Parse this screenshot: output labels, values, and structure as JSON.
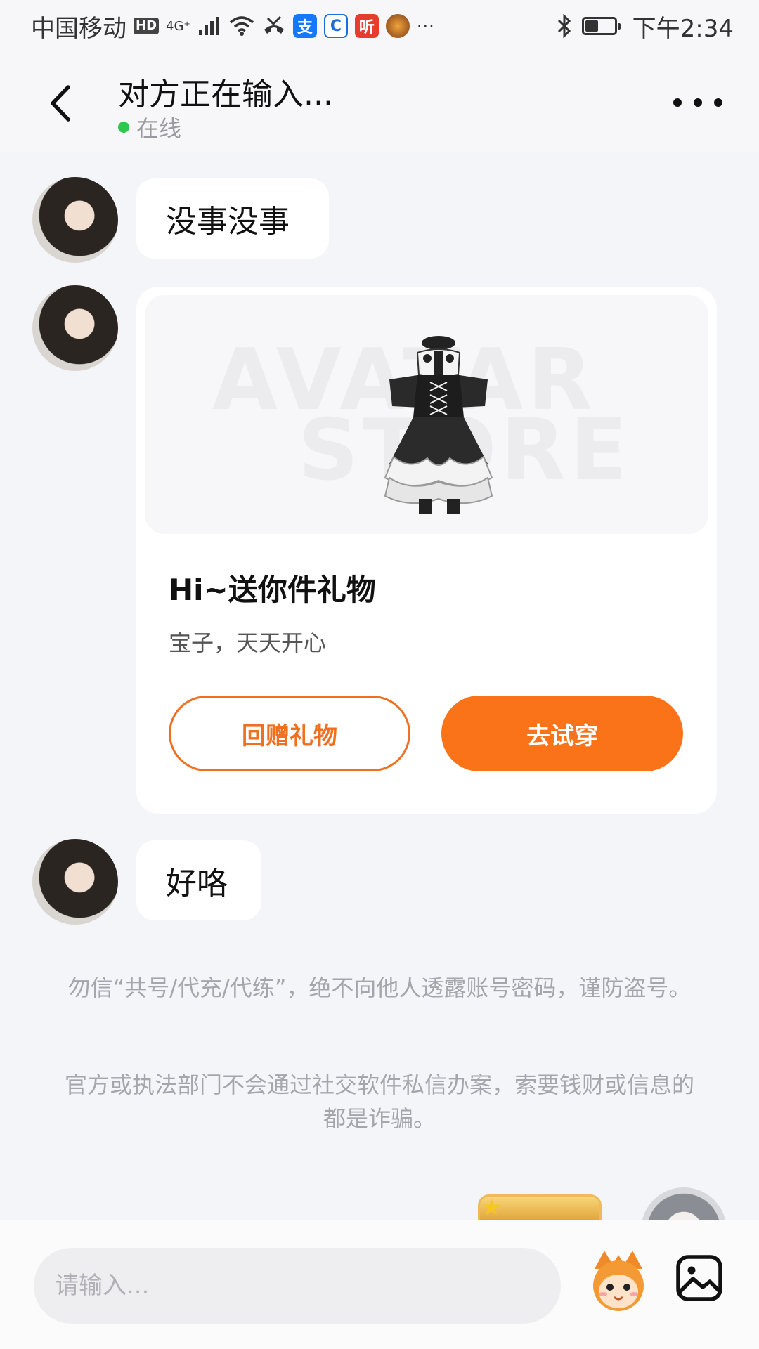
{
  "status_bar": {
    "carrier": "中国移动",
    "hd": "HD",
    "network": "4G⁺",
    "more": "···",
    "app_icons": [
      {
        "name": "missed-call-icon",
        "color": "#333333"
      },
      {
        "name": "alipay-icon",
        "color": "#1677ff",
        "glyph": "支"
      },
      {
        "name": "browser-icon",
        "color": "#1e6fd9",
        "glyph": "⟳"
      },
      {
        "name": "listen-app-icon",
        "color": "#e63d2e",
        "glyph": "听"
      },
      {
        "name": "game-app-icon",
        "color": "#c97a2a",
        "glyph": ""
      }
    ],
    "time": "下午2:34",
    "battery_level": 0.45
  },
  "header": {
    "title": "对方正在输入...",
    "status": "在线",
    "status_color": "#2ec84d"
  },
  "messages": [
    {
      "type": "text",
      "text": "没事没事"
    },
    {
      "type": "gift",
      "title": "Hi~送你件礼物",
      "subtitle": "宝子，天天开心",
      "watermark_top": "AVATAR",
      "watermark_bottom": "STORE",
      "return_label": "回赠礼物",
      "try_label": "去试穿"
    },
    {
      "type": "text",
      "text": "好咯"
    }
  ],
  "notices": [
    "勿信“共号/代充/代练”，绝不向他人透露账号密码，谨防盗号。",
    "官方或执法部门不会通过社交软件私信办案，索要钱财或信息的都是诈骗。"
  ],
  "input": {
    "placeholder": "请输入..."
  },
  "colors": {
    "accent": "#fb7318",
    "background": "#f4f5f8"
  }
}
